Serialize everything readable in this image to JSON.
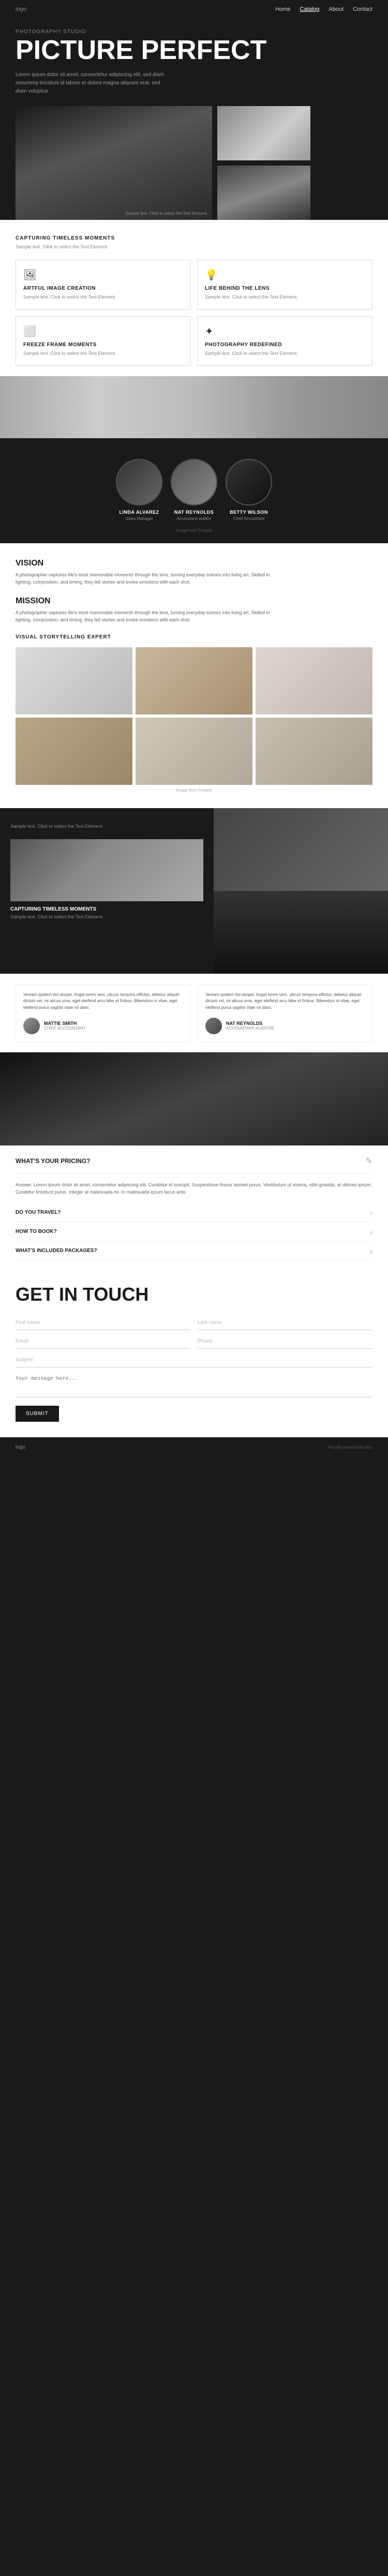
{
  "nav": {
    "logo": "logo",
    "links": [
      "Home",
      "Catalog",
      "About",
      "Contact"
    ],
    "active": "Catalog"
  },
  "hero": {
    "subtitle": "PHOTOGRAPHY STUDIO",
    "title": "PICTURE PERFECT",
    "description": "Lorem ipsum dolor sit amet, consectetur adipiscing elit, sed diam nonummy tincidunt id labore et dolore magna aliquam erat, sed diam voluptua.",
    "sample_text": "Sample text. Click to select the Text Element."
  },
  "capturing": {
    "title": "CAPTURING TIMELESS MOMENTS",
    "sample": "Sample text. Click to select the Text Element."
  },
  "services": [
    {
      "icon": "🖼",
      "title": "ARTFUL IMAGE CREATION",
      "desc": "Sample text. Click to select the Text Element."
    },
    {
      "icon": "💡",
      "title": "LIFE BEHIND THE LENS",
      "desc": "Sample text. Click to select the Text Element."
    },
    {
      "icon": "⬜",
      "title": "FREEZE FRAME MOMENTS",
      "desc": "Sample text. Click to select the Text Element."
    },
    {
      "icon": "✦",
      "title": "PHOTOGRAPHY REDEFINED",
      "desc": "Sample text. Click to select the Text Element."
    }
  ],
  "team": {
    "image_credit": "Image from Freepik",
    "members": [
      {
        "name": "LINDA ALVAREZ",
        "role": "Sales Manager"
      },
      {
        "name": "NAT REYNOLDS",
        "role": "Accountant-auditor"
      },
      {
        "name": "BETTY WILSON",
        "role": "Chief Accountant"
      }
    ]
  },
  "vision": {
    "title": "VISION",
    "text": "A photographer captures life's most memorable moments through the lens, turning everyday scenes into living art. Skilled in lighting, composition, and timing, they tell stories and evoke emotions with each shot."
  },
  "mission": {
    "title": "MISSION",
    "text": "A photographer captures life's most memorable moments through the lens, turning everyday scenes into living art. Skilled in lighting, composition, and timing, they tell stories and evoke emotions with each shot."
  },
  "visual_expert": {
    "title": "VISUAL STORYTELLING EXPERT",
    "image_credit": "Image from Freepik"
  },
  "split": {
    "sample": "Sample text. Click to select the Text Element.",
    "capturing_title": "CAPTURING TIMELESS MOMENTS",
    "capturing_sub": "Sample text. Click to select the Text Element."
  },
  "testimonials": [
    {
      "text": "Veniam quidem dol simper, frugal lorem veni, ulicum tempora efficitur, debetur aliquet dictum vel, mi alicua urna, eget eleifend arcu bibe et finibus. Bibendum in vitae, eget eleifend purus sagittis vitae mi diam.",
      "name": "MATTIE SMITH",
      "role": "CHIEF ACCOUNTANT"
    },
    {
      "text": "Veniam quidem dol simper, frugal lorem veni, ulicum tempora efficitur, debetur aliquet dictum vel, mi alicua urna, eget eleifend arcu bibe et finibus. Bibendum in vitae, eget eleifend purus sagittis vitae mi diam.",
      "name": "NAT REYNOLDS",
      "role": "ACCOUNTANT-AUDITOR"
    }
  ],
  "faq": {
    "pricing": {
      "question": "WHAT'S YOUR PRICING?",
      "edit_icon": "✎",
      "answer": "Answer: Lorem ipsum dolor sit amet, consectetur adipiscing elit. Curabitur id suscipit. Suspendisse finuus laoreet purus. Vestibulum ut viverra, nibh gravida, at ultrices ipsum. Curabitur tincidunt purus. Integer at malesuada mi. In malesuada ipsum lacus ante."
    },
    "items": [
      {
        "question": "DO YOU TRAVEL?"
      },
      {
        "question": "HOW TO BOOK?"
      },
      {
        "question": "WHAT'S INCLUDED PACKAGES?"
      }
    ],
    "chevron": "›"
  },
  "contact": {
    "title": "GET IN TOUCH",
    "fields": {
      "first_name": {
        "placeholder": "First name"
      },
      "last_name": {
        "placeholder": "Last name"
      },
      "email": {
        "placeholder": "Email"
      },
      "phone": {
        "placeholder": "Phone"
      },
      "subject": {
        "placeholder": "Subject"
      },
      "message": {
        "placeholder": "Your message here..."
      }
    },
    "submit": "SUBMIT"
  },
  "footer": {
    "logo": "logo",
    "credit": "Proudly powered by Wix"
  }
}
